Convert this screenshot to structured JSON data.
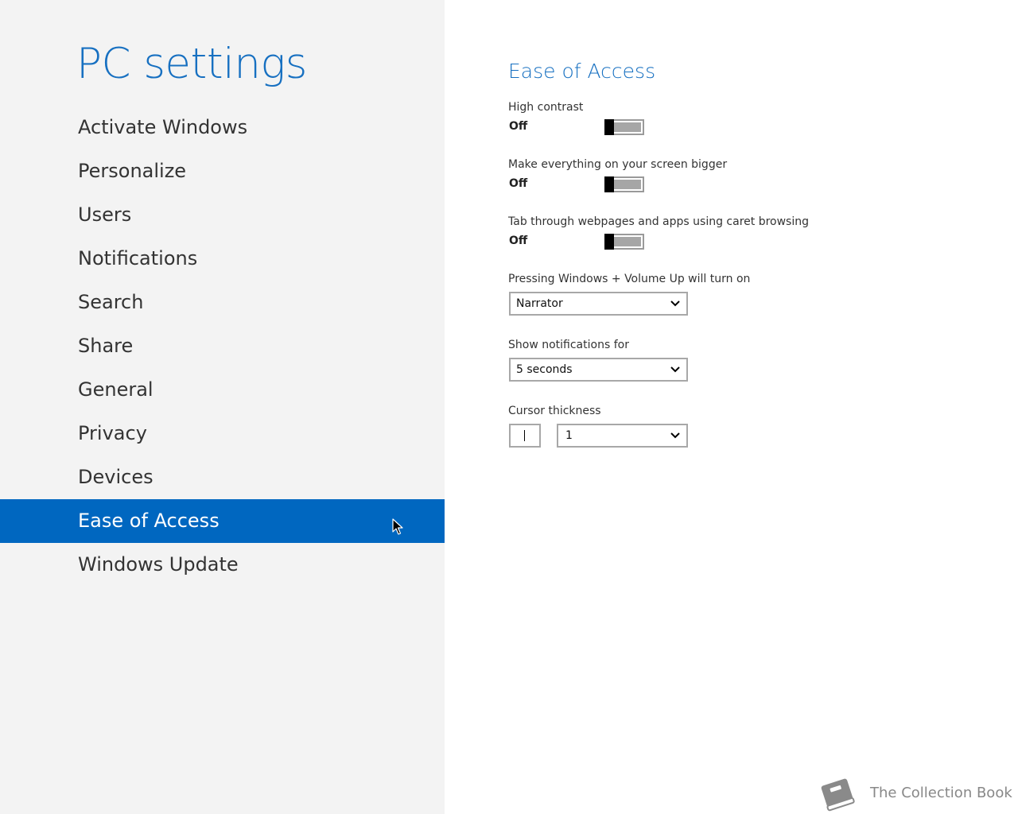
{
  "sidebar": {
    "title": "PC settings",
    "items": [
      {
        "label": "Activate Windows",
        "selected": false
      },
      {
        "label": "Personalize",
        "selected": false
      },
      {
        "label": "Users",
        "selected": false
      },
      {
        "label": "Notifications",
        "selected": false
      },
      {
        "label": "Search",
        "selected": false
      },
      {
        "label": "Share",
        "selected": false
      },
      {
        "label": "General",
        "selected": false
      },
      {
        "label": "Privacy",
        "selected": false
      },
      {
        "label": "Devices",
        "selected": false
      },
      {
        "label": "Ease of Access",
        "selected": true
      },
      {
        "label": "Windows Update",
        "selected": false
      }
    ]
  },
  "main": {
    "title": "Ease of Access",
    "high_contrast": {
      "label": "High contrast",
      "state": "Off"
    },
    "bigger_screen": {
      "label": "Make everything on your screen bigger",
      "state": "Off"
    },
    "caret_browsing": {
      "label": "Tab through webpages and apps using caret browsing",
      "state": "Off"
    },
    "volume_up": {
      "label": "Pressing Windows + Volume Up will turn on",
      "value": "Narrator"
    },
    "notifications": {
      "label": "Show notifications for",
      "value": "5 seconds"
    },
    "cursor": {
      "label": "Cursor thickness",
      "value": "1"
    }
  },
  "watermark": {
    "text": "The Collection Book"
  },
  "colors": {
    "accent": "#1770c1",
    "selection": "#0067c0",
    "sidebar_bg": "#f3f3f3",
    "toggle_track": "#a6a6a6"
  },
  "icons": [
    "pointer-cursor-icon",
    "chevron-down-icon",
    "book-icon"
  ]
}
